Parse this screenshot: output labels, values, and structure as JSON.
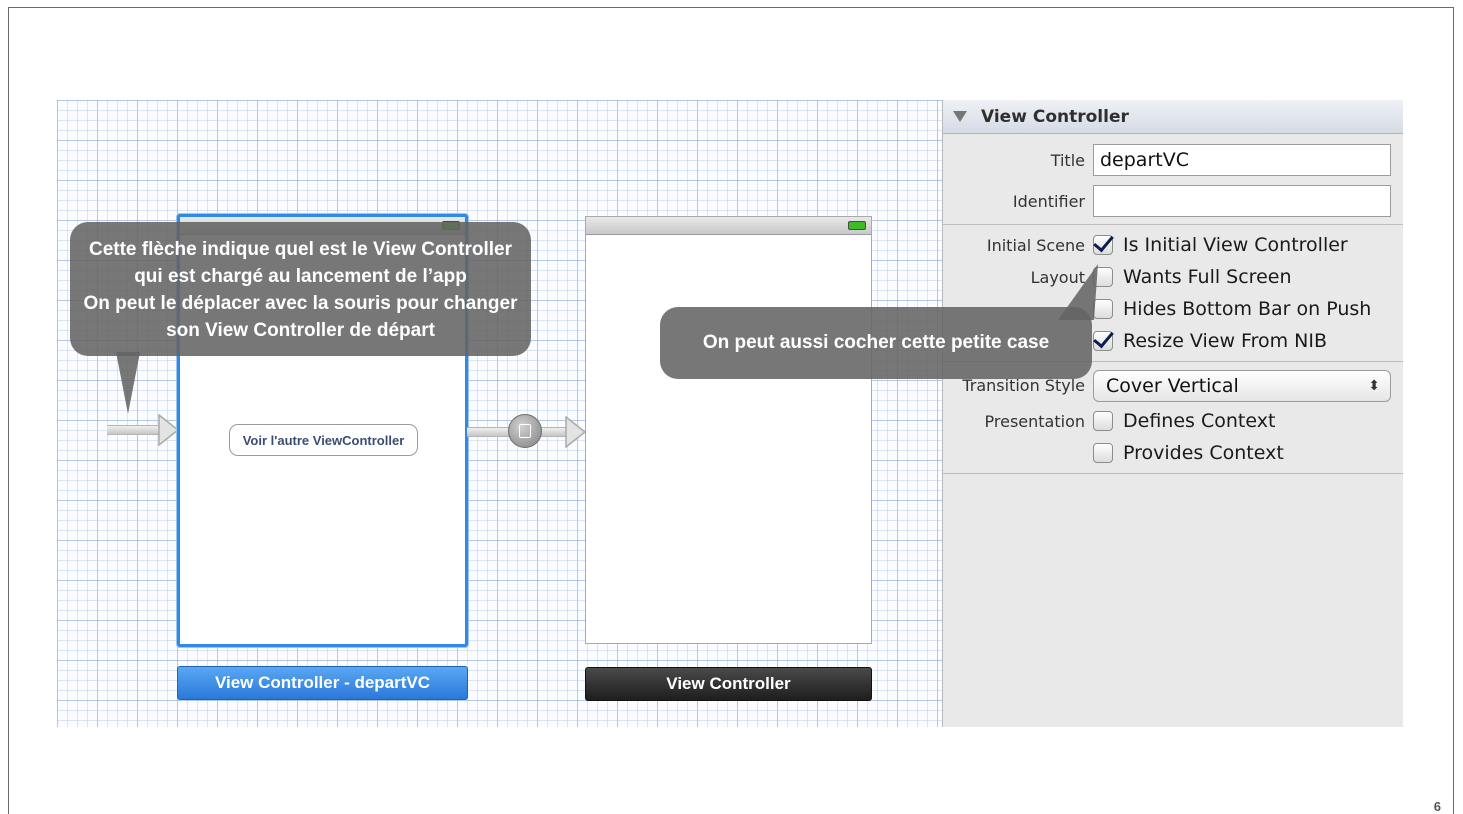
{
  "slide": {
    "page_number": "6"
  },
  "storyboard": {
    "scene1": {
      "button_label": "Voir l'autre ViewController",
      "label": "View Controller - departVC"
    },
    "scene2": {
      "label": "View Controller"
    }
  },
  "callouts": {
    "initial_arrow": [
      "Cette flèche indique quel est le View Controller",
      "qui est chargé au lancement de l’app",
      "On peut le déplacer avec la souris pour changer",
      "son View Controller de départ"
    ],
    "checkbox": "On peut aussi cocher cette petite case"
  },
  "inspector": {
    "header": "View Controller",
    "title_label": "Title",
    "title_value": "departVC",
    "identifier_label": "Identifier",
    "identifier_value": "",
    "initial_scene_label": "Initial Scene",
    "is_initial_label": "Is Initial View Controller",
    "is_initial_checked": true,
    "layout_label": "Layout",
    "wants_full_screen_label": "Wants Full Screen",
    "wants_full_screen_checked": false,
    "hides_bottom_bar_label": "Hides Bottom Bar on Push",
    "hides_bottom_bar_checked": false,
    "resize_from_nib_label": "Resize View From NIB",
    "resize_from_nib_checked": true,
    "transition_label": "Transition Style",
    "transition_value": "Cover Vertical",
    "presentation_label": "Presentation",
    "defines_context_label": "Defines Context",
    "defines_context_checked": false,
    "provides_context_label": "Provides Context",
    "provides_context_checked": false
  }
}
